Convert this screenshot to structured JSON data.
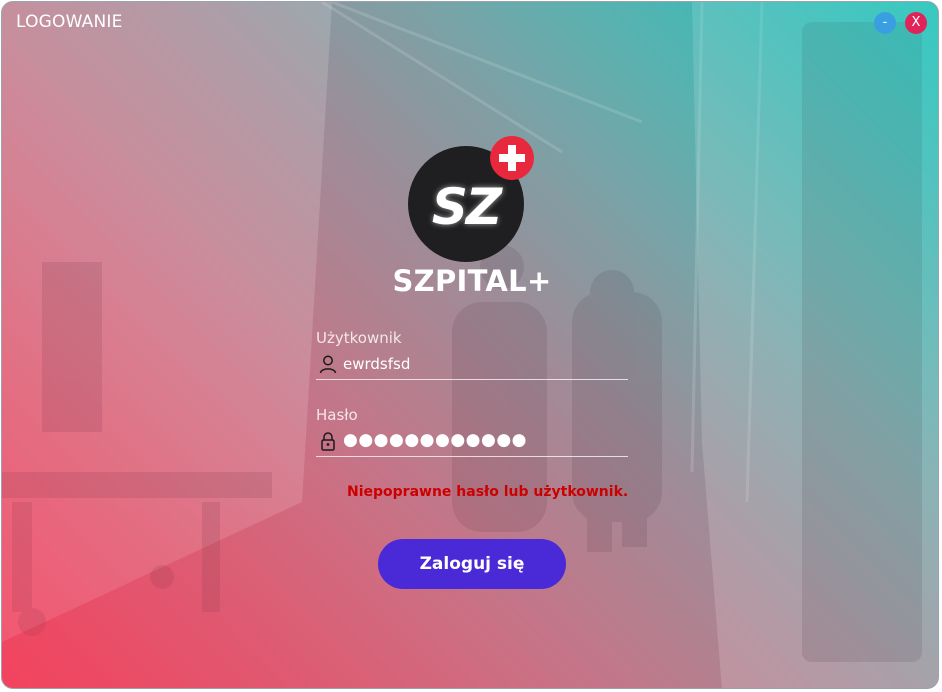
{
  "window": {
    "title": "LOGOWANIE",
    "minimize_label": "-",
    "close_label": "X"
  },
  "brand": {
    "logo_text": "SZ",
    "app_name": "SZPITAL+"
  },
  "form": {
    "username_label": "Użytkownik",
    "username_value": "ewrdsfsd",
    "password_label": "Hasło",
    "password_value": "●●●●●●●●●●●●",
    "error_message": "Niepoprawne hasło lub użytkownik.",
    "login_button_label": "Zaloguj się"
  },
  "icons": {
    "username": "user-icon",
    "password": "lock-icon",
    "logo_badge": "plus-icon"
  },
  "colors": {
    "accent": "#4a2ad6",
    "error": "#cc0000",
    "close": "#e0245a",
    "minimize": "#3a9fe0",
    "logo_badge": "#e8283d"
  }
}
